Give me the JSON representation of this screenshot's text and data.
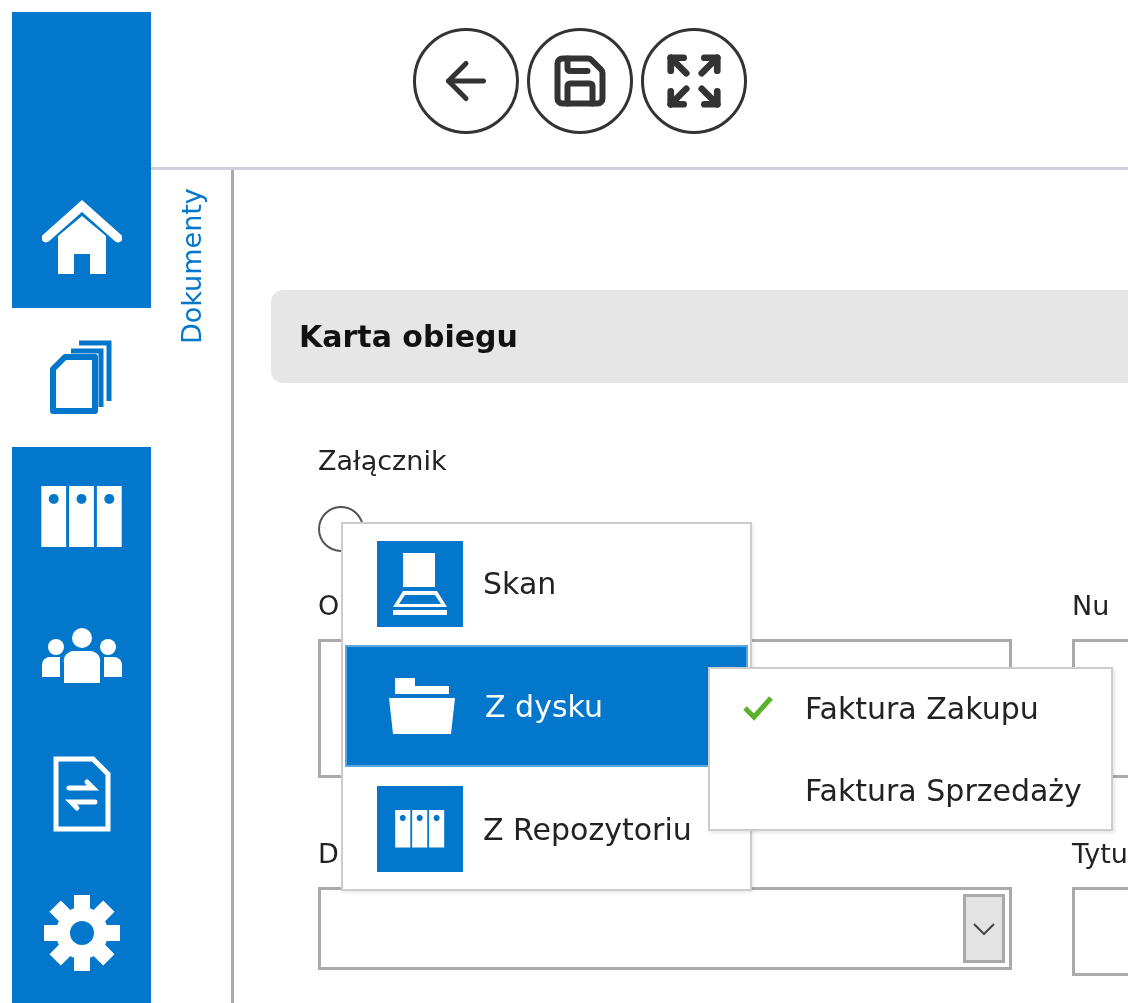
{
  "sidebar": {
    "items": [
      {
        "selected": false
      },
      {
        "selected": true
      },
      {
        "selected": false
      },
      {
        "selected": false
      },
      {
        "selected": false
      },
      {
        "selected": false
      }
    ]
  },
  "side_tab": {
    "label": "Dokumenty"
  },
  "section": {
    "title": "Karta obiegu"
  },
  "attachment": {
    "label": "Załącznik"
  },
  "fields": [
    {
      "label": "O",
      "kind": "textarea"
    },
    {
      "label": "Nu",
      "kind": "text"
    },
    {
      "label": "D",
      "kind": "combo"
    },
    {
      "label": "Tytu",
      "kind": "text"
    }
  ],
  "menu": {
    "items": [
      {
        "label": "Skan",
        "selected": false
      },
      {
        "label": "Z dysku",
        "selected": true
      },
      {
        "label": "Z Repozytoriu",
        "selected": false
      }
    ]
  },
  "submenu": {
    "items": [
      {
        "label": "Faktura Zakupu",
        "checked": true
      },
      {
        "label": "Faktura Sprzedaży",
        "checked": false
      }
    ]
  }
}
